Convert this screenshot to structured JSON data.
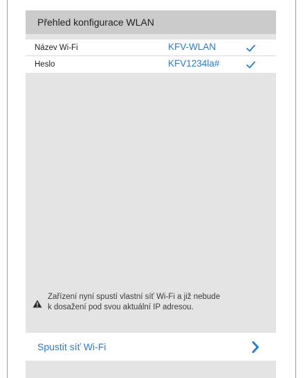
{
  "header": {
    "title": "Přehled konfigurace WLAN"
  },
  "rows": [
    {
      "label": "Název Wi-Fi",
      "value": "KFV-WLAN",
      "status_icon": "checkmark-icon"
    },
    {
      "label": "Heslo",
      "value": "KFV1234la#",
      "status_icon": "checkmark-icon"
    }
  ],
  "warning": {
    "icon": "warning-icon",
    "line1": "Zařízení nyní spustí vlastní síť Wi-Fi a již nebude",
    "line2": "k dosažení pod svou aktuální IP adresou."
  },
  "action": {
    "label": "Spustit síť Wi-Fi",
    "icon": "chevron-right-icon"
  },
  "colors": {
    "accent": "#2e7bc4",
    "header_bg": "#cbcbcb",
    "screen_bg": "#e4e4e4"
  }
}
